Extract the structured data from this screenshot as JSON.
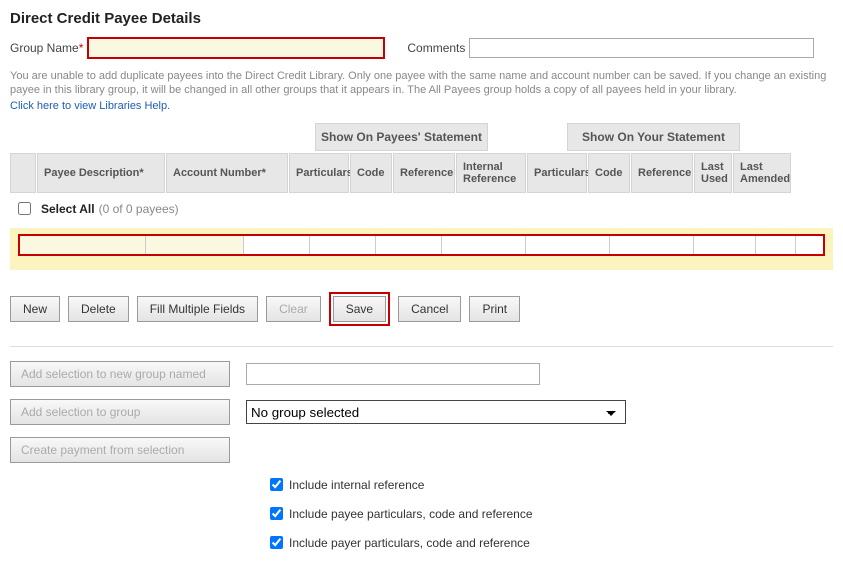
{
  "page": {
    "title": "Direct Credit Payee Details"
  },
  "top": {
    "group_name_label": "Group Name",
    "comments_label": "Comments",
    "group_name_value": "",
    "comments_value": ""
  },
  "info": {
    "line": "You are unable to add duplicate payees into the Direct Credit Library. Only one payee with the same name and account number can be saved. If you change an existing payee in this library group, it will be changed in all other groups that it appears in. The All Payees group holds a copy of all payees held in your library.",
    "link": "Click here to view Libraries Help."
  },
  "grid": {
    "group_headers": {
      "payees": "Show On Payees' Statement",
      "your": "Show On Your Statement"
    },
    "cols": {
      "payee_desc": "Payee Description*",
      "account_no": "Account Number*",
      "particulars": "Particulars",
      "code": "Code",
      "reference": "Reference",
      "internal_ref": "Internal Reference",
      "particulars2": "Particulars",
      "code2": "Code",
      "reference2": "Reference",
      "last_used": "Last Used",
      "last_amended": "Last Amended"
    }
  },
  "select_all": {
    "label": "Select All",
    "counter": "(0 of 0 payees)"
  },
  "buttons": {
    "new": "New",
    "delete": "Delete",
    "fill": "Fill Multiple Fields",
    "clear": "Clear",
    "save": "Save",
    "cancel": "Cancel",
    "print": "Print"
  },
  "lower": {
    "add_new_group": "Add selection to new group named",
    "add_to_group": "Add selection to group",
    "create_payment": "Create payment from selection",
    "new_group_value": "",
    "group_select_value": "No group selected"
  },
  "checks": {
    "c1": "Include internal reference",
    "c2": "Include payee particulars, code and reference",
    "c3": "Include payer particulars, code and reference"
  }
}
